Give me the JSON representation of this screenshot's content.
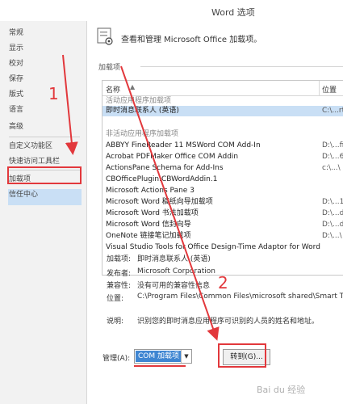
{
  "window": {
    "title": "Word 选项"
  },
  "sidebar": {
    "items": [
      {
        "label": "常规"
      },
      {
        "label": "显示"
      },
      {
        "label": "校对"
      },
      {
        "label": "保存"
      },
      {
        "label": "版式"
      },
      {
        "label": "语言"
      },
      {
        "label": "高级"
      },
      {
        "label": "自定义功能区"
      },
      {
        "label": "快速访问工具栏"
      },
      {
        "label": "加载项"
      },
      {
        "label": "信任中心"
      }
    ],
    "selected": "加载项"
  },
  "main": {
    "header": "查看和管理 Microsoft Office 加载项。",
    "section": "加载项",
    "table": {
      "col_name": "名称",
      "col_sort": "▲",
      "col_location": "位置",
      "active_group": "活动应用程序加载项",
      "active_rows": [
        {
          "name": "即时消息联系人 (英语)",
          "loc": "C:\\...rt"
        }
      ],
      "inactive_group": "非活动应用程序加载项",
      "inactive_rows": [
        {
          "name": "ABBYY FineReader 11 MSWord COM Add-In",
          "loc": "D:\\...fi"
        },
        {
          "name": "Acrobat PDFMaker Office COM Addin",
          "loc": "D:\\...6"
        },
        {
          "name": "ActionsPane Schema for Add-Ins",
          "loc": "c:\\...\\"
        },
        {
          "name": "CBOfficePlugin.CBWordAddin.1",
          "loc": ""
        },
        {
          "name": "Microsoft Actions Pane 3",
          "loc": ""
        },
        {
          "name": "Microsoft Word 稿纸向导加载项",
          "loc": "D:\\...1"
        },
        {
          "name": "Microsoft Word 书法加载项",
          "loc": "D:\\...d"
        },
        {
          "name": "Microsoft Word 信封向导",
          "loc": "D:\\...d"
        },
        {
          "name": "OneNote 链接笔记加载项",
          "loc": "D:\\...\\"
        },
        {
          "name": "Visual Studio Tools for Office Design-Time Adaptor for Word",
          "loc": ""
        }
      ]
    },
    "details": {
      "addin_label": "加载项:",
      "addin_value": "即时消息联系人 (英语)",
      "publisher_label": "发布者:",
      "publisher_value": "Microsoft Corporation",
      "compat_label": "兼容性:",
      "compat_value": "没有可用的兼容性信息",
      "location_label": "位置:",
      "location_value": "C:\\Program Files\\Common Files\\microsoft shared\\Smart Ta",
      "desc_label": "说明:",
      "desc_value": "识别您的即时消息应用程序可识别的人员的姓名和地址。"
    },
    "manage": {
      "label": "管理(A):",
      "select_value": "COM 加载项",
      "goto_button": "转到(G)..."
    }
  },
  "annotations": {
    "step1": "1",
    "step2": "2"
  },
  "watermark": "Bai du 经验"
}
